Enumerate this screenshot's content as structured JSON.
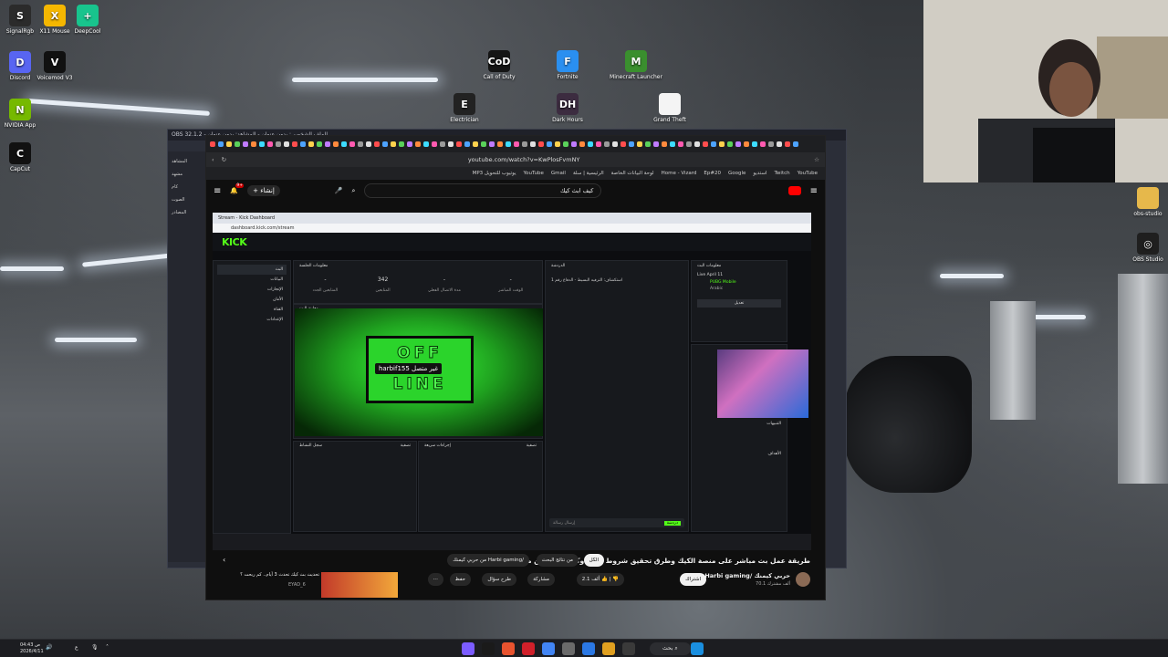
{
  "desktop_icons": [
    {
      "label": "SignalRgb",
      "name": "signalrgb-icon",
      "color": "#2b2b2b",
      "glyph": "S"
    },
    {
      "label": "X11 Mouse",
      "name": "mouse-icon",
      "color": "#f5b700",
      "glyph": "X"
    },
    {
      "label": "DeepCool",
      "name": "deepcool-icon",
      "color": "#18c48d",
      "glyph": "+"
    },
    {
      "label": "Discord",
      "name": "discord-icon",
      "color": "#5865f2",
      "glyph": "D"
    },
    {
      "label": "Voicemod V3",
      "name": "voicemod-icon",
      "color": "#111111",
      "glyph": "V"
    },
    {
      "label": "NVIDIA App",
      "name": "nvidia-icon",
      "color": "#76b900",
      "glyph": "N"
    },
    {
      "label": "CapCut",
      "name": "capcut-icon",
      "color": "#111111",
      "glyph": "C"
    },
    {
      "label": "Call of Duty",
      "name": "callofduty-icon",
      "color": "#151515",
      "glyph": "CoD"
    },
    {
      "label": "Fortnite",
      "name": "fortnite-icon",
      "color": "#2a8ff0",
      "glyph": "F"
    },
    {
      "label": "Minecraft Launcher",
      "name": "minecraft-icon",
      "color": "#3a8f2e",
      "glyph": "M"
    },
    {
      "label": "Electrician",
      "name": "electrician-icon",
      "color": "#222222",
      "glyph": "E"
    },
    {
      "label": "Dark Hours",
      "name": "darkhours-icon",
      "color": "#3c2c40",
      "glyph": "DH"
    },
    {
      "label": "Grand Theft",
      "name": "file-icon",
      "color": "#f4f4f4",
      "glyph": ""
    },
    {
      "label": "obs-studio",
      "name": "folder-icon",
      "color": "#e6b84b",
      "glyph": ""
    },
    {
      "label": "OBS Studio",
      "name": "obs-icon",
      "color": "#1f1f1f",
      "glyph": "◎"
    }
  ],
  "obs": {
    "title": "OBS 32.1.2 - الملف الشخصي: بدون عنوان - المشاهد: بدون عنوان",
    "sidebar": [
      "المشاهد",
      "مشهد",
      "كام",
      "الصوت",
      "المصادر"
    ]
  },
  "browser": {
    "url": "youtube.com/watch?v=KwPlosFvmNY",
    "bookmarks": [
      "YouTube",
      "Twitch",
      "استديو",
      "Google",
      "Ep#20",
      "Home - Vizard",
      "لوحة البيانات الخاصة",
      "الرئيسية | سلة",
      "Gmail",
      "YouTube",
      "يوتيوب للتحويل MP3"
    ]
  },
  "youtube": {
    "search_query": "كيف ابث كيك",
    "create_label": "إنشاء",
    "notifications": "9+",
    "video_title": "طريقة عمل بث مباشر على منصة الكيك وطرق تحقيق شروط الربح وكم الارباح من منصة الكيك.",
    "channel_name": "Harbi gaming/ حربي كيمنك",
    "subscribers": "70.1 ألف مشترك",
    "subscribe_label": "اشتراك",
    "likes": "2.1 ألف",
    "share_label": "مشاركة",
    "ask_label": "طرح سؤال",
    "save_label": "حفظ",
    "filter_all": "الكل",
    "filter_search": "من نتائج البحث",
    "filter_channel": "من حربي كيمنك Harbi gaming/",
    "rec_title": "تحديث بث كيك تحدث 3 أيام.. كم ربحت ؟",
    "rec_channel": "EYAD_6"
  },
  "kick": {
    "logo": "KICK",
    "tab_title": "Stream - Kick Dashboard",
    "url": "dashboard.kick.com/stream",
    "nav": [
      "البث",
      "البيانات",
      "الإنجازات",
      "الأمان",
      "القناة",
      "الإعدادات"
    ],
    "stats_header": "معلومات الجلسة",
    "stats": [
      {
        "value": "-",
        "label": "المتابعين الجدد"
      },
      {
        "value": "342",
        "label": "المتابعين"
      },
      {
        "value": "-",
        "label": "مدة الاتصال الفعلي"
      },
      {
        "value": "-",
        "label": "الوقت المباشر"
      }
    ],
    "preview_header": "معاينة البث",
    "offline_line1": "OFF",
    "offline_line2": "LINE",
    "stream_tag": "harbif155 غير متصل",
    "chat_header": "الدردشة",
    "chat_message": "استكشاف: الترفيه البسيط - الدفاع رقم 1",
    "chat_placeholder": "إرسال رسالة",
    "chat_send": "دردشة",
    "info_header": "معلومات البث",
    "live_title": "Live April 11",
    "category": "PUBG Mobile",
    "language": "Arabic",
    "edit_label": "تعديل",
    "activity_header": "سجل النشاط",
    "quick_actions": "إجراءات سريعة",
    "filter_label": "تصفية",
    "panel_items": [
      "الإجراءات الآلية",
      "الإشعارات",
      "التنبيهات",
      "الأهداف"
    ]
  },
  "taskbar": {
    "search": "بحث",
    "time": "04:43 ص",
    "date": "2026/4/11",
    "lang": "ع"
  }
}
